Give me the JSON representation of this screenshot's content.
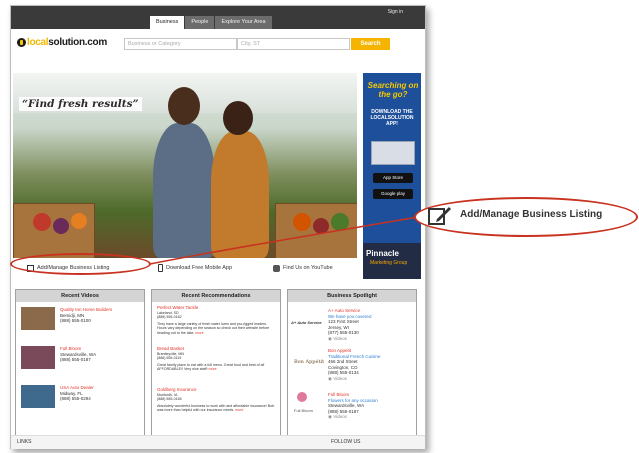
{
  "header": {
    "sign_in": "Sign in",
    "tabs": [
      {
        "label": "Business",
        "active": true
      },
      {
        "label": "People",
        "active": false
      },
      {
        "label": "Explore Your Area",
        "active": false
      }
    ]
  },
  "logo": {
    "local": "local",
    "rest": "solution.com"
  },
  "search": {
    "business_placeholder": "Business or Category",
    "location_placeholder": "City, ST",
    "button": "Search"
  },
  "hero": {
    "quote": "“Find fresh results”"
  },
  "ad": {
    "headline": "Searching on the go?",
    "sub": "DOWNLOAD THE LOCALSOLUTION APP!",
    "store1": "App Store",
    "store2": "Google play",
    "brand": "Pinnacle",
    "brand_sub": "Marketing Group"
  },
  "actions": {
    "add_listing": "Add/Manage Business Listing",
    "mobile_app": "Download Free Mobile App",
    "youtube": "Find Us on YouTube"
  },
  "panels": {
    "videos": {
      "title": "Recent Videos",
      "items": [
        {
          "name": "Quality Inn Home Builders",
          "city": "Bemidji, MN",
          "phone": "(888) 555-0100"
        },
        {
          "name": "Full Bloom",
          "city": "Stewardsville, WA",
          "phone": "(888) 555-0187"
        },
        {
          "name": "USA Auto Dealer",
          "city": "Midway, FL",
          "phone": "(888) 555-0294"
        }
      ]
    },
    "recs": {
      "title": "Recent Recommendations",
      "items": [
        {
          "name": "Perfect Water Tackle",
          "city": "Lakeland, SD",
          "phone": "(888) 555-0162",
          "text": "They have a large variety of fresh water lures and pro-rigged leaders. Hours vary depending on the season so check out their website before heading out to the lake.",
          "more": "more"
        },
        {
          "name": "Bread Basket",
          "city": "Brantleyville, MN",
          "phone": "(888) 555-0119",
          "text": "Great family place to eat with a full menu. Great food and best of all AFFORDABLE!! Very nice staff!",
          "more": "more"
        },
        {
          "name": "Goldberg Insurance",
          "city": "Munfordk, IA",
          "phone": "(888) 555-0165",
          "text": "Absolutely wonderful business to work with and affordable insurance! Bob was more than helpful with our insurance needs.",
          "more": "more"
        }
      ]
    },
    "spotlight": {
      "title": "Business Spotlight",
      "items": [
        {
          "logo": "A+ Auto Service",
          "name": "A+ Auto Service",
          "tagline": "We have you covered",
          "street": "123 First Street",
          "city": "Jersey, WI",
          "phone": "(877) 555-0130",
          "videos": "Videos"
        },
        {
          "logo": "Bon Appétit",
          "name": "Bon Appetit",
          "tagline": "Traditional French Cuisine",
          "street": "456 2nd Street",
          "city": "Covington, CO",
          "phone": "(888) 555-0134",
          "videos": "Videos"
        },
        {
          "logo": "Full Bloom",
          "name": "Full Bloom",
          "tagline": "Flowers for any occasion",
          "city": "Stewardsville, WA",
          "phone": "(888) 555-0187",
          "videos": "Videos"
        }
      ]
    }
  },
  "footer": {
    "links": "LINKS",
    "follow": "FOLLOW US"
  },
  "callout": {
    "label": "Add/Manage Business Listing"
  },
  "colors": {
    "accent": "#f5b400",
    "annotation": "#c8321f",
    "link_red": "#e0352b",
    "link_blue": "#2e7fd0"
  }
}
